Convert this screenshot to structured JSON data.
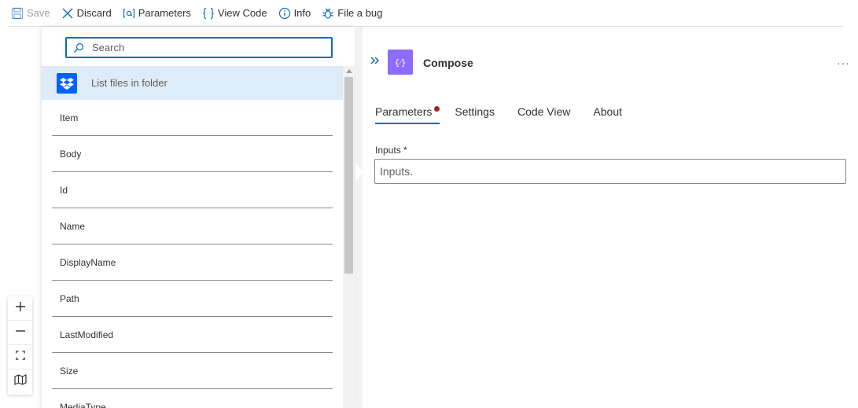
{
  "toolbar": {
    "save_label": "Save",
    "discard_label": "Discard",
    "parameters_label": "Parameters",
    "view_code_label": "View Code",
    "info_label": "Info",
    "file_bug_label": "File a bug"
  },
  "dynamic_content": {
    "search_placeholder": "Search",
    "group_title": "List files in folder",
    "group_icon": "dropbox-icon",
    "tokens": [
      "Item",
      "Body",
      "Id",
      "Name",
      "DisplayName",
      "Path",
      "LastModified",
      "Size",
      "MediaType"
    ]
  },
  "zoom_controls": {
    "icons": [
      "zoom-in-icon",
      "zoom-out-icon",
      "fit-view-icon",
      "minimap-icon"
    ]
  },
  "panel": {
    "action_title": "Compose",
    "action_icon_glyph": "{⁄}",
    "more_label": "···",
    "tabs": [
      "Parameters",
      "Settings",
      "Code View",
      "About"
    ],
    "inputs_label": "Inputs *",
    "inputs_placeholder": "Inputs."
  },
  "colors": {
    "accent": "#0f6cbd",
    "compose_icon_bg": "#8c6cff",
    "dropbox_blue": "#0061fe",
    "selected_row_bg": "#deecf9",
    "error_dot": "#a4262c"
  }
}
